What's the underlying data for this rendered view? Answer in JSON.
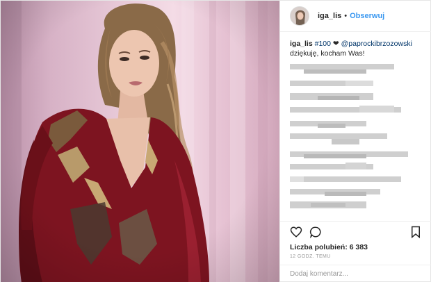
{
  "post": {
    "username": "iga_lis",
    "separator": "•",
    "follow_label": "Obserwuj",
    "caption": {
      "user": "iga_lis",
      "hashtag": "#100",
      "heart": "❤",
      "mention": "@paprockibrzozowski",
      "line2": "dziękuję, kocham Was!"
    },
    "likes": "Liczba polubień: 6 383",
    "time": "12 GODZ. TEMU",
    "comment_placeholder": "Dodaj komentarz..."
  },
  "icons": [
    "heart-icon",
    "comment-icon",
    "bookmark-icon"
  ],
  "colors": {
    "accent": "#3897f0",
    "link": "#003569",
    "border": "#efefef",
    "muted": "#999999",
    "dress": "#7d1420",
    "background_wall": "#e9cbd9"
  }
}
